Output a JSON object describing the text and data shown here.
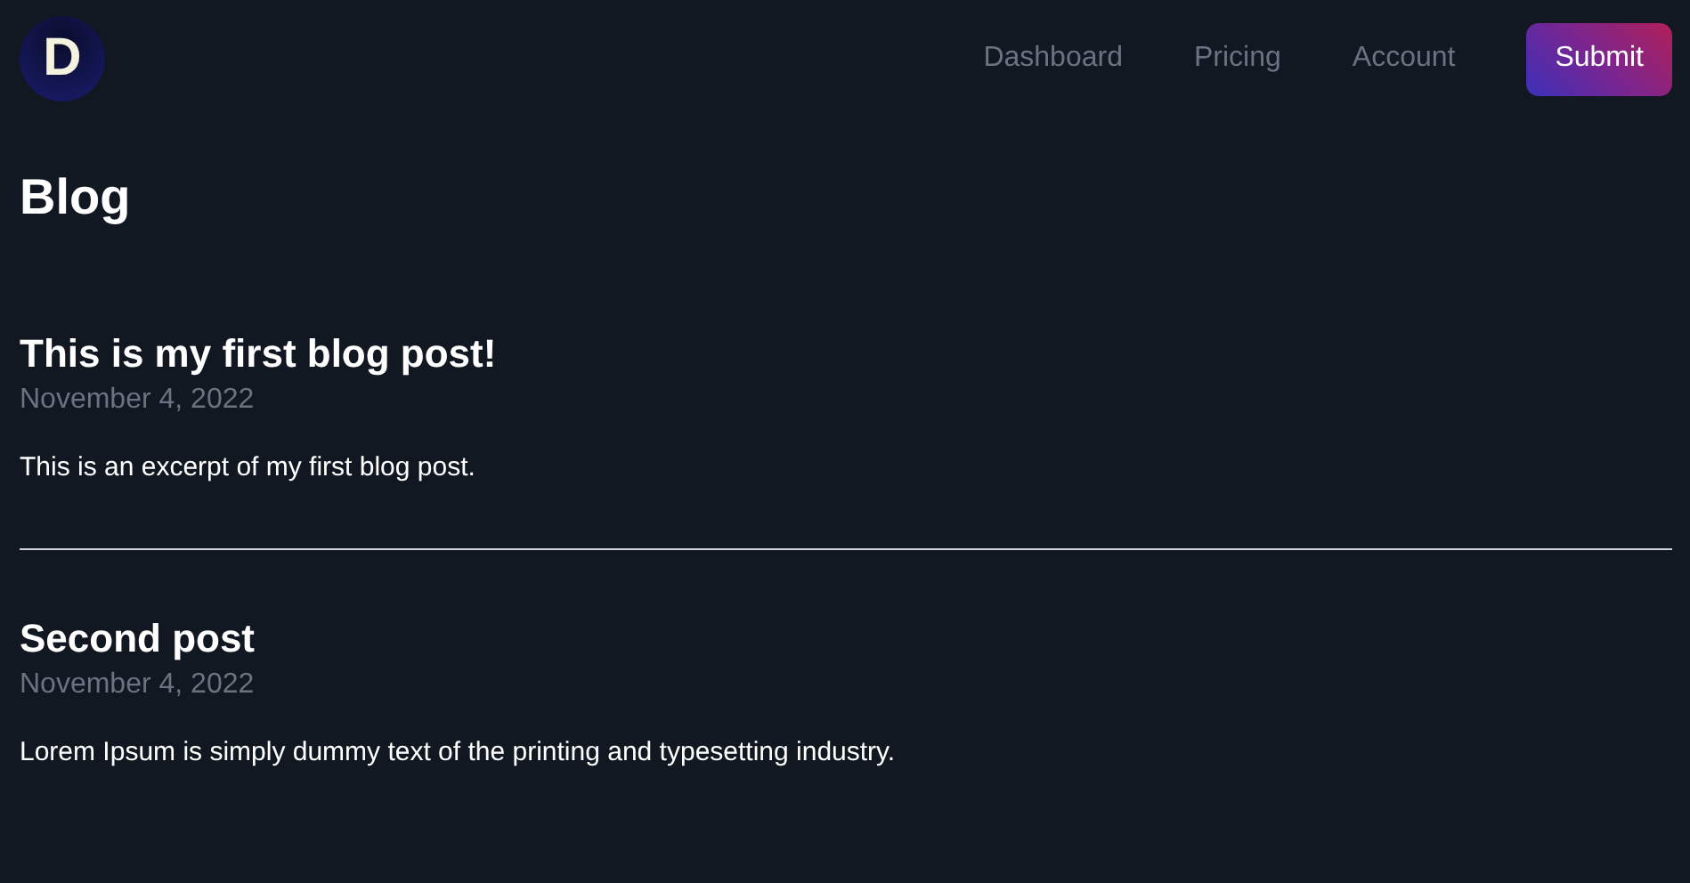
{
  "header": {
    "logo": "D",
    "nav": [
      {
        "label": "Dashboard"
      },
      {
        "label": "Pricing"
      },
      {
        "label": "Account"
      }
    ],
    "action": "Submit"
  },
  "title": "Blog",
  "posts": [
    {
      "title": "This is my first blog post!",
      "date": "November 4, 2022",
      "excerpt": "This is an excerpt of my first blog post."
    },
    {
      "title": "Second post",
      "date": "November 4, 2022",
      "excerpt": "Lorem Ipsum is simply dummy text of the printing and typesetting industry."
    }
  ]
}
